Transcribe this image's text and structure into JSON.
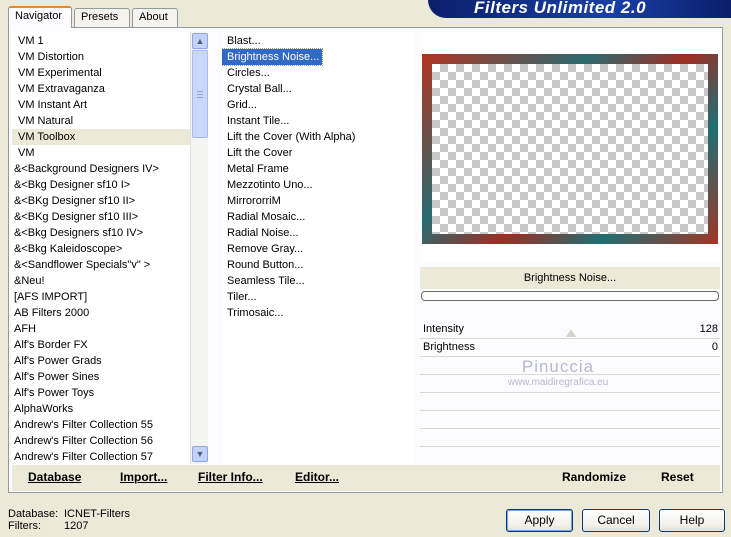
{
  "header": {
    "tabs": [
      {
        "label": "Navigator",
        "active": true
      },
      {
        "label": "Presets",
        "active": false
      },
      {
        "label": "About",
        "active": false
      }
    ],
    "brand": "Filters Unlimited 2.0"
  },
  "categories": {
    "items": [
      "VM 1",
      "VM Distortion",
      "VM Experimental",
      "VM Extravaganza",
      "VM Instant Art",
      "VM Natural",
      "VM Toolbox",
      "VM",
      "&<Background Designers IV>",
      "&<Bkg Designer sf10 I>",
      "&<BKg Designer sf10 II>",
      "&<BKg Designer sf10 III>",
      "&<Bkg Designers sf10 IV>",
      "&<Bkg Kaleidoscope>",
      "&<Sandflower Specials\"v\" >",
      "&Neu!",
      "[AFS IMPORT]",
      "AB Filters 2000",
      "AFH",
      "Alf's Border FX",
      "Alf's Power Grads",
      "Alf's Power Sines",
      "Alf's Power Toys",
      "AlphaWorks",
      "Andrew's Filter Collection 55",
      "Andrew's Filter Collection 56",
      "Andrew's Filter Collection 57"
    ],
    "selected": "VM Toolbox"
  },
  "filters": {
    "items": [
      "Blast...",
      "Brightness Noise...",
      "Circles...",
      "Crystal Ball...",
      "Grid...",
      "Instant Tile...",
      "Lift the Cover (With Alpha)",
      "Lift the Cover",
      "Metal Frame",
      "Mezzotinto Uno...",
      "MirrororriM",
      "Radial Mosaic...",
      "Radial Noise...",
      "Remove Gray...",
      "Round Button...",
      "Seamless Tile...",
      "Tiler...",
      "Trimosaic..."
    ],
    "selected": "Brightness Noise..."
  },
  "preview": {
    "filter_name": "Brightness Noise...",
    "progress_percent": 0
  },
  "params": [
    {
      "label": "Intensity",
      "value": "128"
    },
    {
      "label": "Brightness",
      "value": "0"
    }
  ],
  "watermark": {
    "name": "Pinuccia",
    "url": "www.maidiregrafica.eu"
  },
  "bottom_bar": {
    "database": "Database",
    "import": "Import...",
    "filter_info": "Filter Info...",
    "editor": "Editor...",
    "randomize": "Randomize",
    "reset": "Reset"
  },
  "status": {
    "database_label": "Database:",
    "database_value": "ICNET-Filters",
    "filters_label": "Filters:",
    "filters_value": "1207"
  },
  "buttons": {
    "apply": "Apply",
    "cancel": "Cancel",
    "help": "Help"
  },
  "colors": {
    "selection_blue": "#316ac5",
    "brand_blue": "#0a1f6b",
    "tab_accent": "#e68b2c"
  }
}
